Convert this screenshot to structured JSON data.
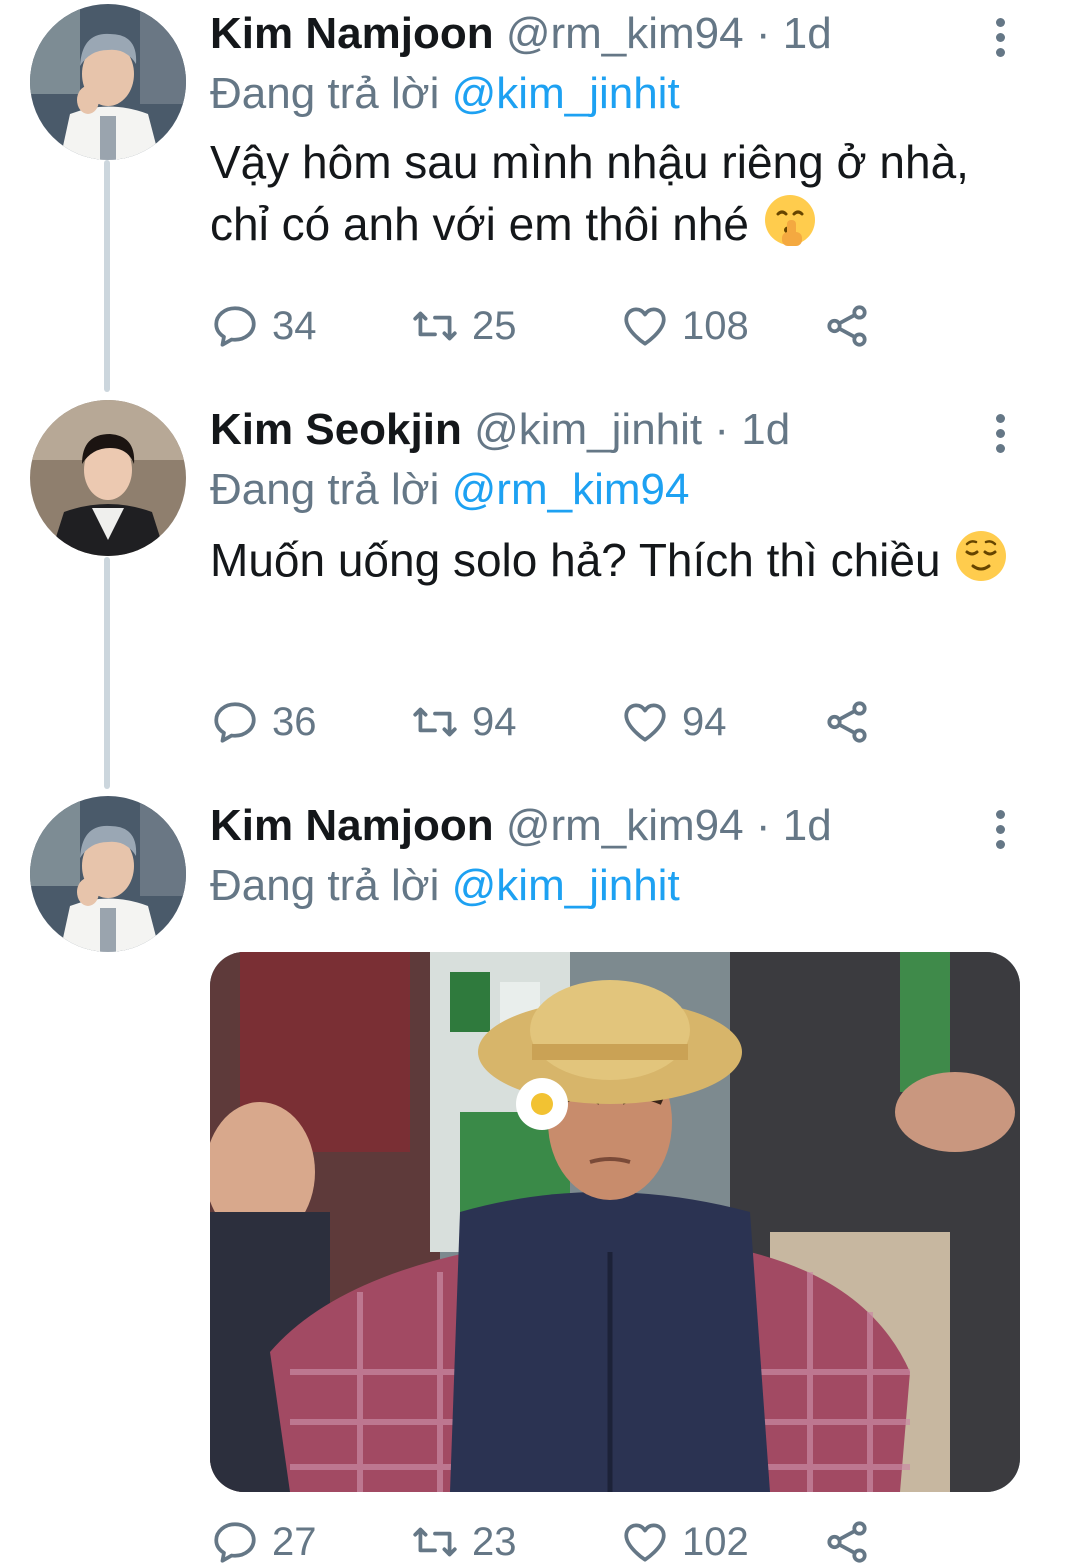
{
  "colors": {
    "accent": "#1da1f2",
    "secondary_text": "#657786",
    "primary_text": "#14171a",
    "thread_line": "#ccd6dd"
  },
  "tweets": [
    {
      "name": "Kim Namjoon",
      "handle": "@rm_kim94",
      "separator": "·",
      "time": "1d",
      "reply_prefix": "Đang trả lời",
      "reply_to": "@kim_jinhit",
      "text": "Vậy hôm sau mình nhậu riêng ở nhà, chỉ có anh với em thôi nhé",
      "emoji": "shushing-face-emoji",
      "replies": "34",
      "retweets": "25",
      "likes": "108"
    },
    {
      "name": "Kim Seokjin",
      "handle": "@kim_jinhit",
      "separator": "·",
      "time": "1d",
      "reply_prefix": "Đang trả lời",
      "reply_to": "@rm_kim94",
      "text": "Muốn uống solo hả? Thích thì chiều",
      "emoji": "relieved-face-emoji",
      "replies": "36",
      "retweets": "94",
      "likes": "94"
    },
    {
      "name": "Kim Namjoon",
      "handle": "@rm_kim94",
      "separator": "·",
      "time": "1d",
      "reply_prefix": "Đang trả lời",
      "reply_to": "@kim_jinhit",
      "media": "man-in-straw-hat-meme-photo",
      "replies": "27",
      "retweets": "23",
      "likes": "102"
    }
  ],
  "icons": {
    "reply": "reply-icon",
    "retweet": "retweet-icon",
    "like": "heart-icon",
    "share": "share-icon",
    "more": "more-vertical-icon"
  }
}
